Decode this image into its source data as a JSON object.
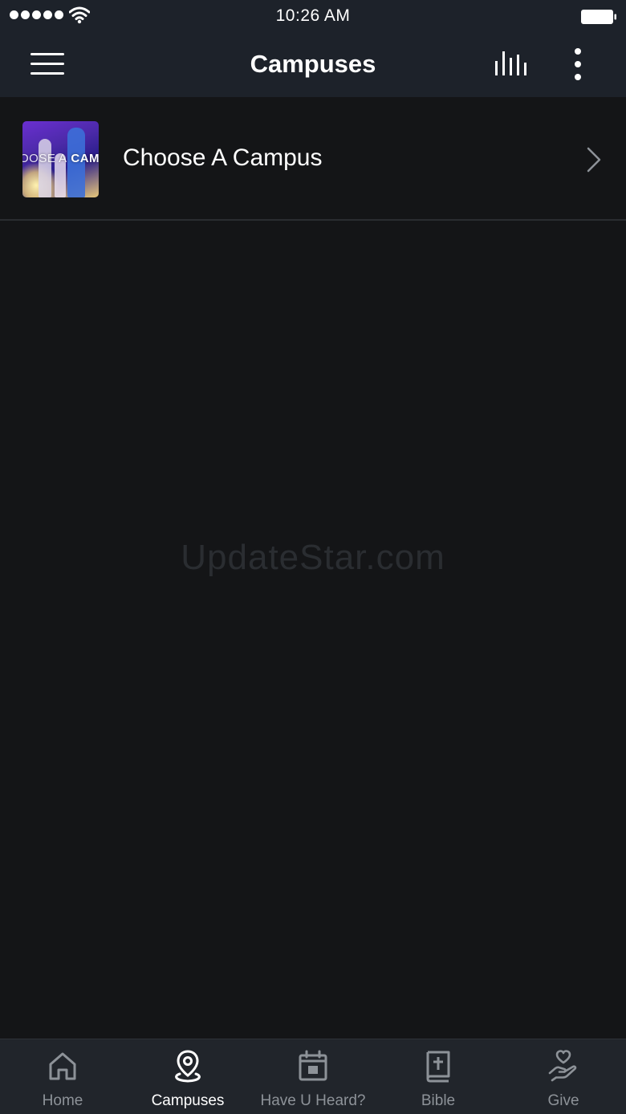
{
  "status_bar": {
    "time": "10:26 AM",
    "signal_icon": "signal-dots-icon",
    "wifi_icon": "wifi-icon",
    "battery_icon": "battery-full-icon"
  },
  "nav": {
    "title": "Campuses",
    "menu_icon": "hamburger-menu-icon",
    "audio_icon": "audio-bars-icon",
    "more_icon": "more-vertical-icon"
  },
  "list": {
    "items": [
      {
        "label": "Choose A Campus",
        "thumbnail_text_light": "OOSE A",
        "thumbnail_text_bold": "CAMI",
        "chevron_icon": "chevron-right-icon"
      }
    ]
  },
  "watermark": "UpdateStar.com",
  "tabs": [
    {
      "label": "Home",
      "icon": "home-icon",
      "active": false
    },
    {
      "label": "Campuses",
      "icon": "map-pin-icon",
      "active": true
    },
    {
      "label": "Have U Heard?",
      "icon": "calendar-icon",
      "active": false
    },
    {
      "label": "Bible",
      "icon": "bible-icon",
      "active": false
    },
    {
      "label": "Give",
      "icon": "give-hand-heart-icon",
      "active": false
    }
  ],
  "colors": {
    "background": "#141517",
    "bar_background": "#1d222a",
    "tab_bar_background": "#21252b",
    "tab_inactive": "#8d9298",
    "tab_active": "#ffffff"
  }
}
